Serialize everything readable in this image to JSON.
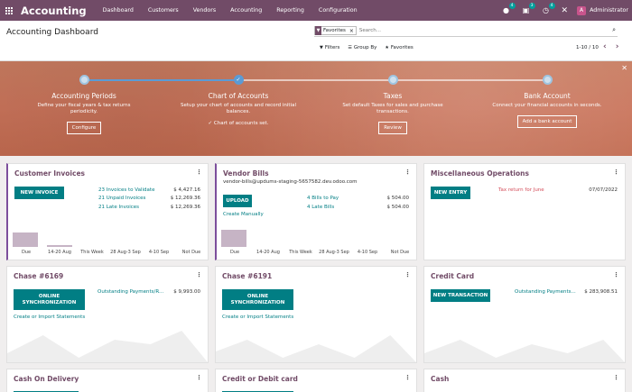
{
  "navbar": {
    "app_title": "Accounting",
    "menu": [
      "Dashboard",
      "Customers",
      "Vendors",
      "Accounting",
      "Reporting",
      "Configuration"
    ],
    "chat_badge": "4",
    "activity_badge": "3",
    "clock_badge": "4",
    "avatar_letter": "A",
    "user_name": "Administrator"
  },
  "control_panel": {
    "title": "Accounting Dashboard",
    "facet_label": "Favorites",
    "search_placeholder": "Search...",
    "filters_label": "Filters",
    "groupby_label": "Group By",
    "favorites_label": "Favorites",
    "pager": "1-10 / 10"
  },
  "onboarding": {
    "progress_fraction": 0.333,
    "steps": [
      {
        "title": "Accounting Periods",
        "desc": "Define your fiscal years & tax returns periodicity.",
        "button": "Configure",
        "done": false
      },
      {
        "title": "Chart of Accounts",
        "desc": "Setup your chart of accounts and record initial balances.",
        "done_text": "Chart of accounts set.",
        "done": true
      },
      {
        "title": "Taxes",
        "desc": "Set default Taxes for sales and purchase transactions.",
        "button": "Review",
        "done": false
      },
      {
        "title": "Bank Account",
        "desc": "Connect your financial accounts in seconds.",
        "button": "Add a bank account",
        "done": false
      }
    ]
  },
  "cards": {
    "customer_invoices": {
      "title": "Customer Invoices",
      "button": "NEW INVOICE",
      "rows": [
        {
          "label": "23 Invoices to Validate",
          "amount": "$ 4,427.16"
        },
        {
          "label": "21 Unpaid Invoices",
          "amount": "$ 12,269.36"
        },
        {
          "label": "21 Late Invoices",
          "amount": "$ 12,269.36"
        }
      ],
      "chart_labels": [
        "Due",
        "14-20 Aug",
        "This Week",
        "28 Aug-3 Sep",
        "4-10 Sep",
        "Not Due"
      ]
    },
    "vendor_bills": {
      "title": "Vendor Bills",
      "email": "vendor-bills@updums-staging-5657582.dev.odoo.com",
      "button": "UPLOAD",
      "manual": "Create Manually",
      "rows": [
        {
          "label": "4 Bills to Pay",
          "amount": "$ 504.00"
        },
        {
          "label": "4 Late Bills",
          "amount": "$ 504.00"
        }
      ],
      "chart_labels": [
        "Due",
        "14-20 Aug",
        "This Week",
        "28 Aug-3 Sep",
        "4-10 Sep",
        "Not Due"
      ]
    },
    "misc_operations": {
      "title": "Miscellaneous Operations",
      "button": "NEW ENTRY",
      "item": "Tax return for June",
      "date": "07/07/2022"
    },
    "chase_6169": {
      "title": "Chase #6169",
      "button_line1": "ONLINE",
      "button_line2": "SYNCHRONIZATION",
      "link": "Outstanding Payments/R...",
      "amount": "$ 9,993.00",
      "secondary": "Create or Import Statements"
    },
    "chase_6191": {
      "title": "Chase #6191",
      "button_line1": "ONLINE",
      "button_line2": "SYNCHRONIZATION",
      "secondary": "Create or Import Statements"
    },
    "credit_card": {
      "title": "Credit Card",
      "button": "NEW TRANSACTION",
      "link": "Outstanding Payments...",
      "amount": "$ 283,908.51"
    },
    "cash_on_delivery": {
      "title": "Cash On Delivery"
    },
    "credit_debit": {
      "title": "Credit or Debit card"
    },
    "cash": {
      "title": "Cash"
    }
  }
}
